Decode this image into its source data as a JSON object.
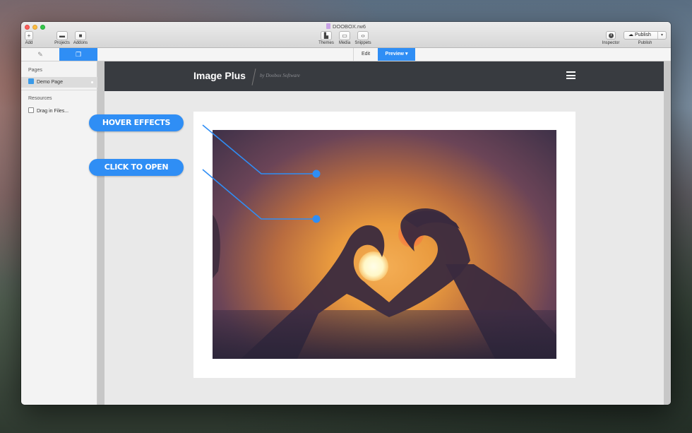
{
  "window": {
    "title": "DOOBOX.rw6"
  },
  "toolbar": {
    "add_label": "Add",
    "add_icon": "+",
    "projects_label": "Projects",
    "addons_label": "Addons",
    "themes_label": "Themes",
    "media_label": "Media",
    "snippets_label": "Snippets",
    "inspector_label": "Inspector",
    "publish_button": "Publish",
    "publish_label": "Publish"
  },
  "tabs": {
    "edit": "Edit",
    "preview": "Preview"
  },
  "sidebar": {
    "pages_heading": "Pages",
    "pages": [
      {
        "label": "Demo Page"
      }
    ],
    "resources_heading": "Resources",
    "resources": [
      {
        "label": "Drag in Files..."
      }
    ]
  },
  "site": {
    "title": "Image Plus",
    "subtitle": "by Doobox Software"
  },
  "callouts": [
    {
      "label": "HOVER EFFECTS"
    },
    {
      "label": "CLICK TO OPEN"
    }
  ],
  "colors": {
    "accent": "#2f8ef5",
    "header_bg": "#383b40"
  }
}
